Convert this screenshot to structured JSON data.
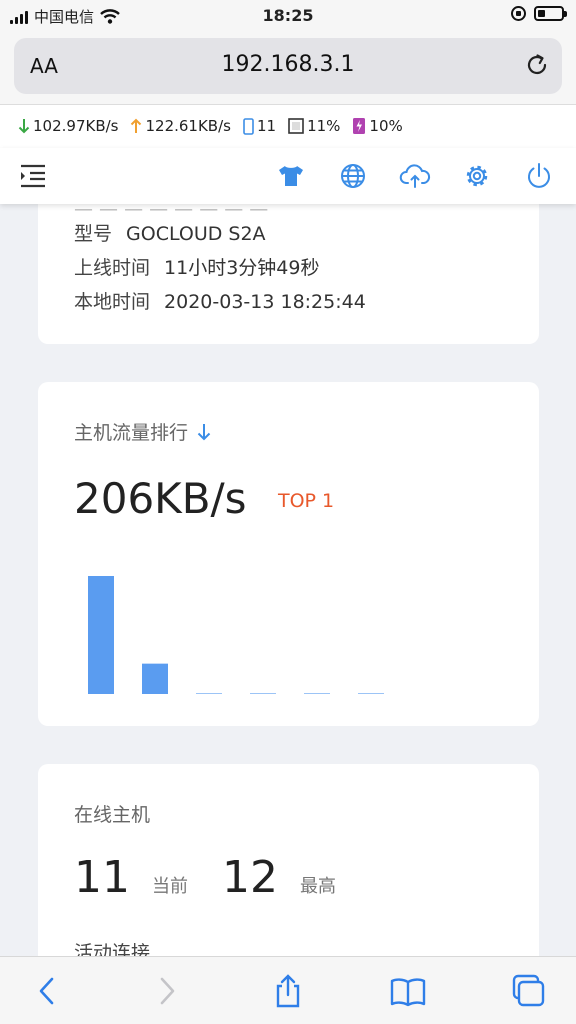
{
  "status_bar": {
    "carrier": "中国电信",
    "time": "18:25",
    "battery_level": 0.3
  },
  "browser": {
    "text_size_label": "AA",
    "url": "192.168.3.1"
  },
  "stats": {
    "download": "102.97KB/s",
    "upload": "122.61KB/s",
    "devices": "11",
    "cpu": "11%",
    "memory": "10%"
  },
  "system_info": {
    "rows": [
      {
        "label": "型号",
        "value": "GOCLOUD S2A"
      },
      {
        "label": "上线时间",
        "value": "11小时3分钟49秒"
      },
      {
        "label": "本地时间",
        "value": "2020-03-13 18:25:44"
      }
    ]
  },
  "traffic_ranking": {
    "title": "主机流量排行",
    "top_value": "206KB/s",
    "top_badge": "TOP 1",
    "bar_color": "#5a9cf0"
  },
  "chart_data": {
    "type": "bar",
    "categories": [
      "",
      "",
      "",
      "",
      "",
      ""
    ],
    "values": [
      206,
      53,
      1.5,
      1,
      0.6,
      0.4
    ],
    "ylim": [
      0,
      206
    ],
    "title": "",
    "xlabel": "",
    "ylabel": ""
  },
  "online_hosts": {
    "title": "在线主机",
    "current_value": "11",
    "current_label": "当前",
    "max_value": "12",
    "max_label": "最高",
    "connections_label": "活动连接"
  },
  "accent_color": "#3b8de6"
}
